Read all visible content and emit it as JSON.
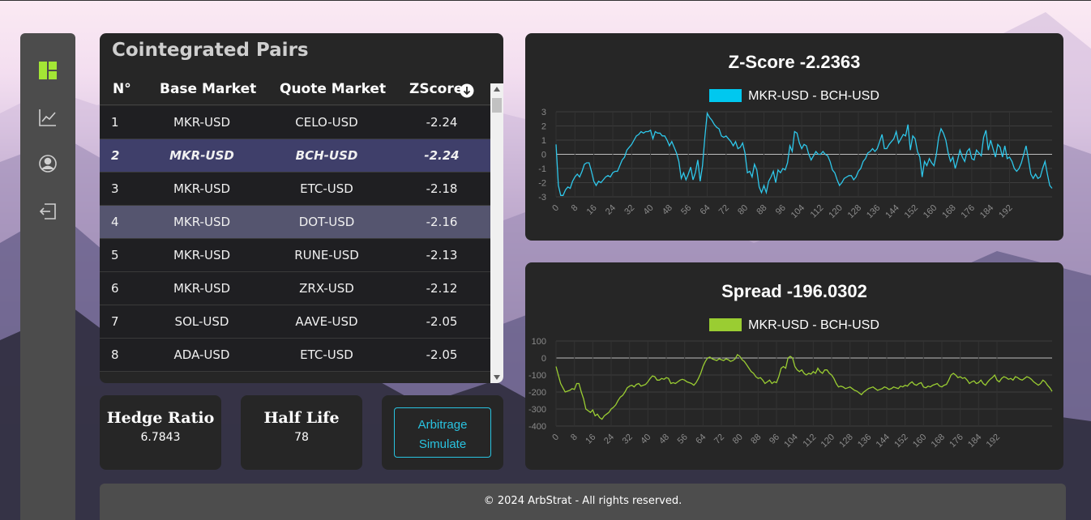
{
  "nav": {
    "items": [
      {
        "icon": "dashboard-icon",
        "active": true
      },
      {
        "icon": "chart-line-icon",
        "active": false
      },
      {
        "icon": "user-icon",
        "active": false
      },
      {
        "icon": "logout-icon",
        "active": false
      }
    ],
    "active_color": "#a3e635"
  },
  "pairs": {
    "title": "Cointegrated Pairs",
    "headers": {
      "n": "N°",
      "base": "Base Market",
      "quote": "Quote Market",
      "zscore": "ZScore"
    },
    "rows": [
      {
        "n": "1",
        "base": "MKR-USD",
        "quote": "CELO-USD",
        "z": "-2.24"
      },
      {
        "n": "2",
        "base": "MKR-USD",
        "quote": "BCH-USD",
        "z": "-2.24"
      },
      {
        "n": "3",
        "base": "MKR-USD",
        "quote": "ETC-USD",
        "z": "-2.18"
      },
      {
        "n": "4",
        "base": "MKR-USD",
        "quote": "DOT-USD",
        "z": "-2.16"
      },
      {
        "n": "5",
        "base": "MKR-USD",
        "quote": "RUNE-USD",
        "z": "-2.13"
      },
      {
        "n": "6",
        "base": "MKR-USD",
        "quote": "ZRX-USD",
        "z": "-2.12"
      },
      {
        "n": "7",
        "base": "SOL-USD",
        "quote": "AAVE-USD",
        "z": "-2.05"
      },
      {
        "n": "8",
        "base": "ADA-USD",
        "quote": "ETC-USD",
        "z": "-2.05"
      }
    ]
  },
  "stats": {
    "hedge_label": "Hedge Ratio",
    "hedge_value": "6.7843",
    "half_label": "Half Life",
    "half_value": "78",
    "simulate_line1": "Arbitrage",
    "simulate_line2": "Simulate"
  },
  "footer": {
    "text": "© 2024 ArbStrat - All rights reserved."
  },
  "chart_data": [
    {
      "type": "line",
      "title": "Z-Score -2.2363",
      "series": [
        {
          "name": "MKR-USD - BCH-USD",
          "color": "#2ec7ea",
          "values": [
            0.7,
            -2.2,
            -2.9,
            -2.9,
            -2.5,
            -2.3,
            -2.4,
            -1.9,
            -1.6,
            -1.4,
            -1.6,
            -1.2,
            -0.7,
            -0.6,
            -0.6,
            -1.2,
            -1.9,
            -2.2,
            -1.9,
            -2.0,
            -1.8,
            -1.6,
            -1.5,
            -1.6,
            -1.3,
            -1.2,
            -1.2,
            -0.8,
            -0.4,
            -0.2,
            0.3,
            0.5,
            0.7,
            1.0,
            1.3,
            1.4,
            1.6,
            1.5,
            1.6,
            1.6,
            1.7,
            1.1,
            1.6,
            1.5,
            1.5,
            1.3,
            1.3,
            1.0,
            0.6,
            0.9,
            0.5,
            0.1,
            -0.5,
            -1.7,
            -1.3,
            -1.8,
            -1.4,
            -0.9,
            -1.8,
            -1.3,
            -0.4,
            -1.9,
            -0.8,
            1.2,
            2.9,
            2.6,
            2.4,
            2.1,
            1.9,
            1.8,
            1.3,
            1.2,
            1.3,
            1.1,
            0.9,
            0.6,
            0.9,
            0.4,
            0.5,
            0.8,
            0.1,
            -1.3,
            -1.2,
            -1.6,
            -0.7,
            -1.1,
            -2.3,
            -2.7,
            -2.2,
            -2.7,
            -1.9,
            -1.6,
            -1.2,
            -2.0,
            -1.1,
            -1.3,
            -1.0,
            -1.1,
            -0.6,
            0.6,
            0.2,
            1.6,
            1.5,
            0.8,
            0.4,
            0.7,
            0.6,
            0.0,
            -0.4,
            -0.1,
            0.2,
            0.0,
            0.0,
            0.2,
            0.0,
            -0.1,
            -0.5,
            -1.1,
            -1.3,
            -1.8,
            -2.2,
            -2.0,
            -1.7,
            -1.6,
            -1.5,
            -1.5,
            -1.8,
            -1.6,
            -1.2,
            -1.0,
            -0.5,
            -0.3,
            0.1,
            0.2,
            0.4,
            0.2,
            0.4,
            0.9,
            1.4,
            0.4,
            0.4,
            0.7,
            0.9,
            1.1,
            1.6,
            0.8,
            1.1,
            1.4,
            1.3,
            2.1,
            0.3,
            1.3,
            1.1,
            0.2,
            -0.2,
            -1.6,
            -0.5,
            -0.8,
            -0.3,
            -0.6,
            -0.8,
            0.0,
            1.2,
            1.8,
            1.5,
            1.0,
            0.1,
            -0.5,
            -0.2,
            -1.0,
            -0.4,
            0.3,
            -0.2,
            -0.5,
            0.2,
            0.4,
            -0.3,
            -0.4,
            0.3,
            0.1,
            -0.1,
            1.2,
            1.7,
            0.3,
            1.0,
            0.4,
            -0.2,
            0.7,
            0.5,
            -0.2,
            0.6,
            -0.3,
            -0.2,
            -0.5,
            -1.0,
            -1.2,
            -1.0,
            -0.6,
            0.0,
            0.6,
            -0.4,
            -1.4,
            -1.7,
            -1.4,
            -1.7,
            -1.6,
            -1.0,
            -0.5,
            -1.4,
            -2.2,
            -2.4
          ]
        }
      ],
      "ylim": [
        -3,
        3
      ],
      "yticks": [
        -3,
        -2,
        -1,
        0,
        1,
        2,
        3
      ],
      "xticks": [
        "0",
        "8",
        "16",
        "24",
        "32",
        "40",
        "48",
        "56",
        "64",
        "72",
        "80",
        "88",
        "96",
        "104",
        "112",
        "120",
        "128",
        "136",
        "144",
        "152",
        "160",
        "168",
        "176",
        "184",
        "192"
      ],
      "reference_line": 0,
      "grid": true,
      "legend": "top-center"
    },
    {
      "type": "line",
      "title": "Spread -196.0302",
      "series": [
        {
          "name": "MKR-USD - BCH-USD",
          "color": "#9acd32",
          "values": [
            -50,
            -100,
            -150,
            -175,
            -200,
            -195,
            -190,
            -180,
            -185,
            -150,
            -150,
            -200,
            -240,
            -300,
            -310,
            -320,
            -305,
            -340,
            -330,
            -350,
            -360,
            -340,
            -330,
            -320,
            -300,
            -290,
            -275,
            -250,
            -230,
            -220,
            -200,
            -175,
            -165,
            -160,
            -170,
            -155,
            -150,
            -165,
            -160,
            -155,
            -140,
            -120,
            -105,
            -110,
            -130,
            -130,
            -120,
            -125,
            -115,
            -120,
            -150,
            -145,
            -150,
            -140,
            -130,
            -125,
            -130,
            -140,
            -145,
            -150,
            -160,
            -145,
            -120,
            -90,
            -50,
            -20,
            0,
            5,
            -5,
            -10,
            -15,
            -5,
            -10,
            -15,
            -5,
            -10,
            -20,
            -15,
            -5,
            20,
            10,
            -10,
            -20,
            -40,
            -60,
            -80,
            -90,
            -110,
            -120,
            -115,
            -130,
            -150,
            -140,
            -130,
            -150,
            -140,
            -145,
            -110,
            -60,
            -50,
            -60,
            0,
            10,
            0,
            -50,
            -70,
            -80,
            -70,
            -90,
            -100,
            -90,
            -95,
            -80,
            -90,
            -60,
            -80,
            -90,
            -70,
            -70,
            -90,
            -100,
            -120,
            -150,
            -170,
            -165,
            -170,
            -180,
            -175,
            -170,
            -180,
            -190,
            -195,
            -205,
            -215,
            -200,
            -190,
            -180,
            -175,
            -170,
            -180,
            -190,
            -185,
            -180,
            -170,
            -175,
            -185,
            -180,
            -170,
            -175,
            -180,
            -165,
            -170,
            -160,
            -165,
            -150,
            -140,
            -155,
            -160,
            -150,
            -145,
            -170,
            -175,
            -165,
            -170,
            -160,
            -155,
            -150,
            -165,
            -170,
            -160,
            -155,
            -130,
            -100,
            -90,
            -100,
            -115,
            -110,
            -120,
            -115,
            -130,
            -150,
            -140,
            -135,
            -150,
            -145,
            -130,
            -150,
            -160,
            -140,
            -125,
            -115,
            -100,
            -130,
            -140,
            -120,
            -110,
            -115,
            -125,
            -120,
            -130,
            -110,
            -115,
            -125,
            -130,
            -120,
            -110,
            -115,
            -125,
            -140,
            -150,
            -160,
            -150,
            -130,
            -140,
            -160,
            -175,
            -196
          ]
        }
      ],
      "ylim": [
        -400,
        100
      ],
      "yticks": [
        -400,
        -300,
        -200,
        -100,
        0,
        100
      ],
      "xticks": [
        "0",
        "8",
        "16",
        "24",
        "32",
        "40",
        "48",
        "56",
        "64",
        "72",
        "80",
        "88",
        "96",
        "104",
        "112",
        "120",
        "128",
        "136",
        "144",
        "152",
        "160",
        "168",
        "176",
        "184",
        "192"
      ],
      "reference_line": 0,
      "grid": true,
      "legend": "top-center"
    }
  ]
}
